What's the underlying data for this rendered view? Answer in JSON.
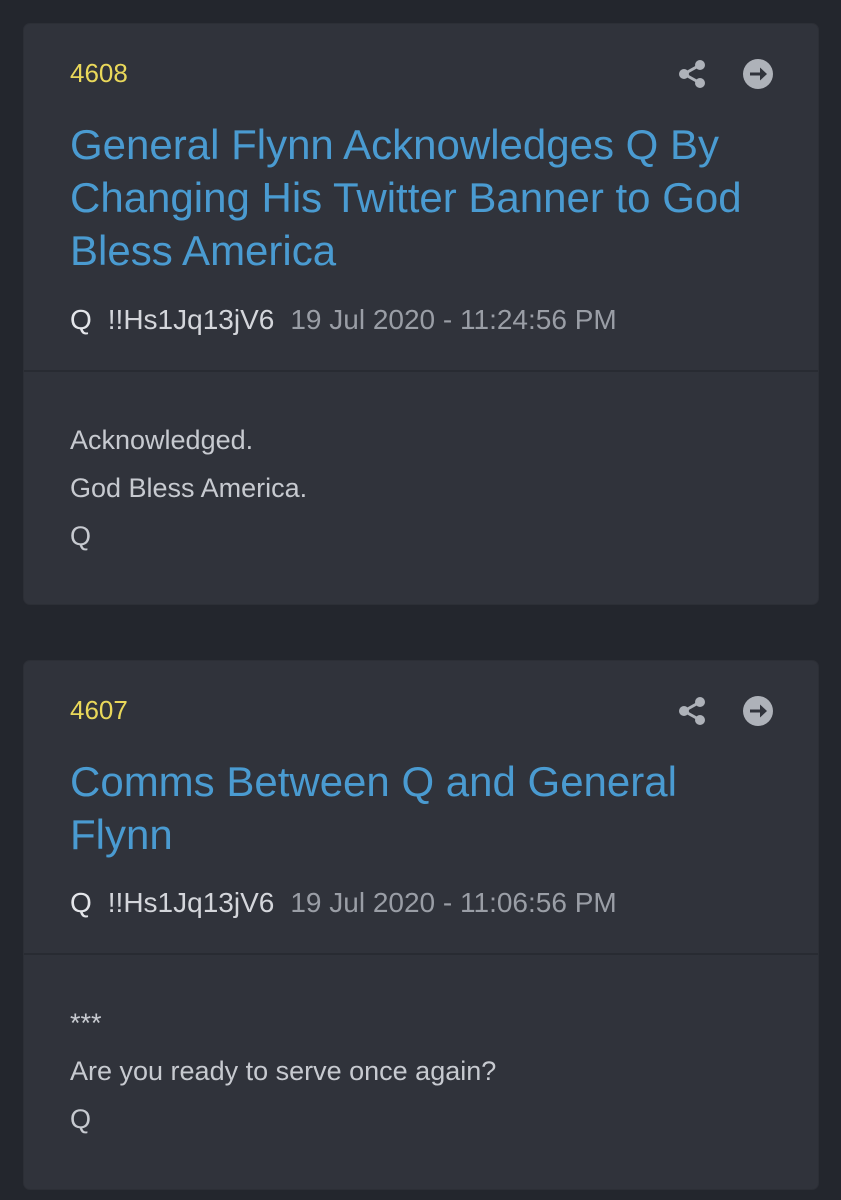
{
  "posts": [
    {
      "number": "4608",
      "title": "General Flynn Acknowledges Q By Changing His Twitter Banner to God Bless America",
      "author": "Q",
      "tripcode": "!!Hs1Jq13jV6",
      "date": "19 Jul 2020 - 11:24:56 PM",
      "body": [
        "Acknowledged.",
        "God Bless America.",
        "Q"
      ],
      "icons": {
        "share": "share-icon",
        "open": "arrow-circle-right-icon"
      }
    },
    {
      "number": "4607",
      "title": "Comms Between Q and General Flynn",
      "author": "Q",
      "tripcode": "!!Hs1Jq13jV6",
      "date": "19 Jul 2020 - 11:06:56 PM",
      "body": [
        "***",
        "Are you ready to serve once again?",
        "Q"
      ],
      "icons": {
        "share": "share-icon",
        "open": "arrow-circle-right-icon"
      }
    }
  ],
  "colors": {
    "background": "#23262d",
    "card": "#30333b",
    "number": "#e9d85a",
    "title": "#4a9bd1",
    "date": "#9a9ea6",
    "body": "#c7cad0"
  }
}
